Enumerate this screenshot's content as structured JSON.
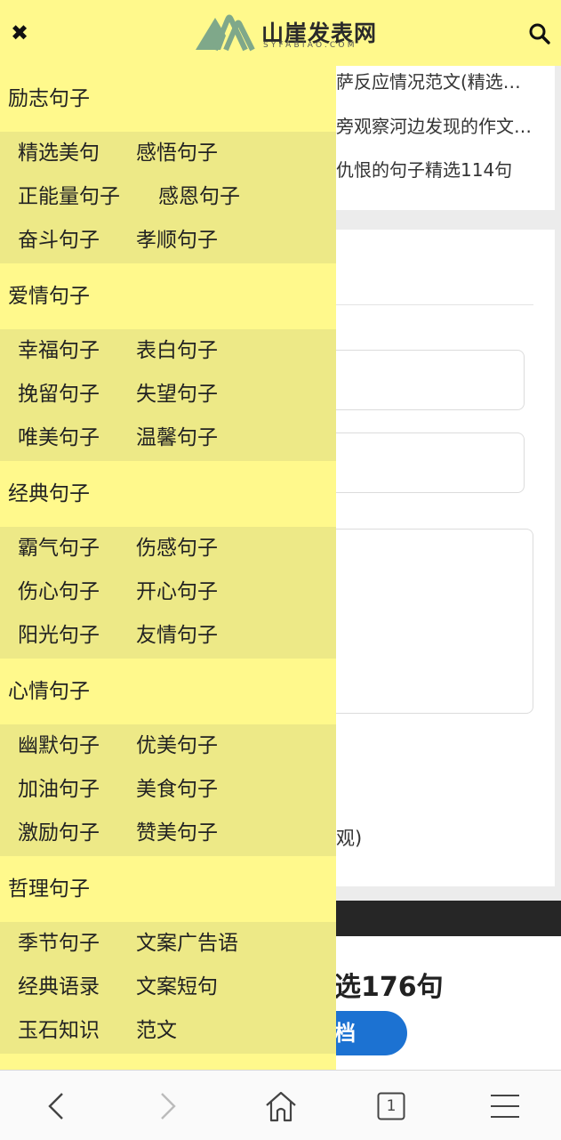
{
  "header": {
    "site_name": "山崖发表网",
    "site_sub": "SYFABIAO.COM",
    "close_glyph": "✖"
  },
  "background": {
    "links": [
      "萨反应情况范文(精选…",
      "旁观察河边发现的作文…",
      "仇恨的句子精选114句"
    ],
    "obscured_text": "观)",
    "article_heading": "选176句",
    "pill_label": "档"
  },
  "drawer": {
    "categories": [
      {
        "title": "励志句子",
        "items": [
          "精选美句",
          "感悟句子",
          "正能量句子",
          "感恩句子",
          "奋斗句子",
          "孝顺句子"
        ]
      },
      {
        "title": "爱情句子",
        "items": [
          "幸福句子",
          "表白句子",
          "挽留句子",
          "失望句子",
          "唯美句子",
          "温馨句子"
        ]
      },
      {
        "title": "经典句子",
        "items": [
          "霸气句子",
          "伤感句子",
          "伤心句子",
          "开心句子",
          "阳光句子",
          "友情句子"
        ]
      },
      {
        "title": "心情句子",
        "items": [
          "幽默句子",
          "优美句子",
          "加油句子",
          "美食句子",
          "激励句子",
          "赞美句子"
        ]
      },
      {
        "title": "哲理句子",
        "items": [
          "季节句子",
          "文案广告语",
          "经典语录",
          "文案短句",
          "玉石知识",
          "范文"
        ]
      }
    ]
  },
  "bottom_nav": {
    "tab_count": "1"
  },
  "colors": {
    "header_bg": "#fff98c",
    "submenu_bg": "#ede987",
    "accent_blue": "#1c72d2",
    "logo_green": "#7fa88a"
  }
}
